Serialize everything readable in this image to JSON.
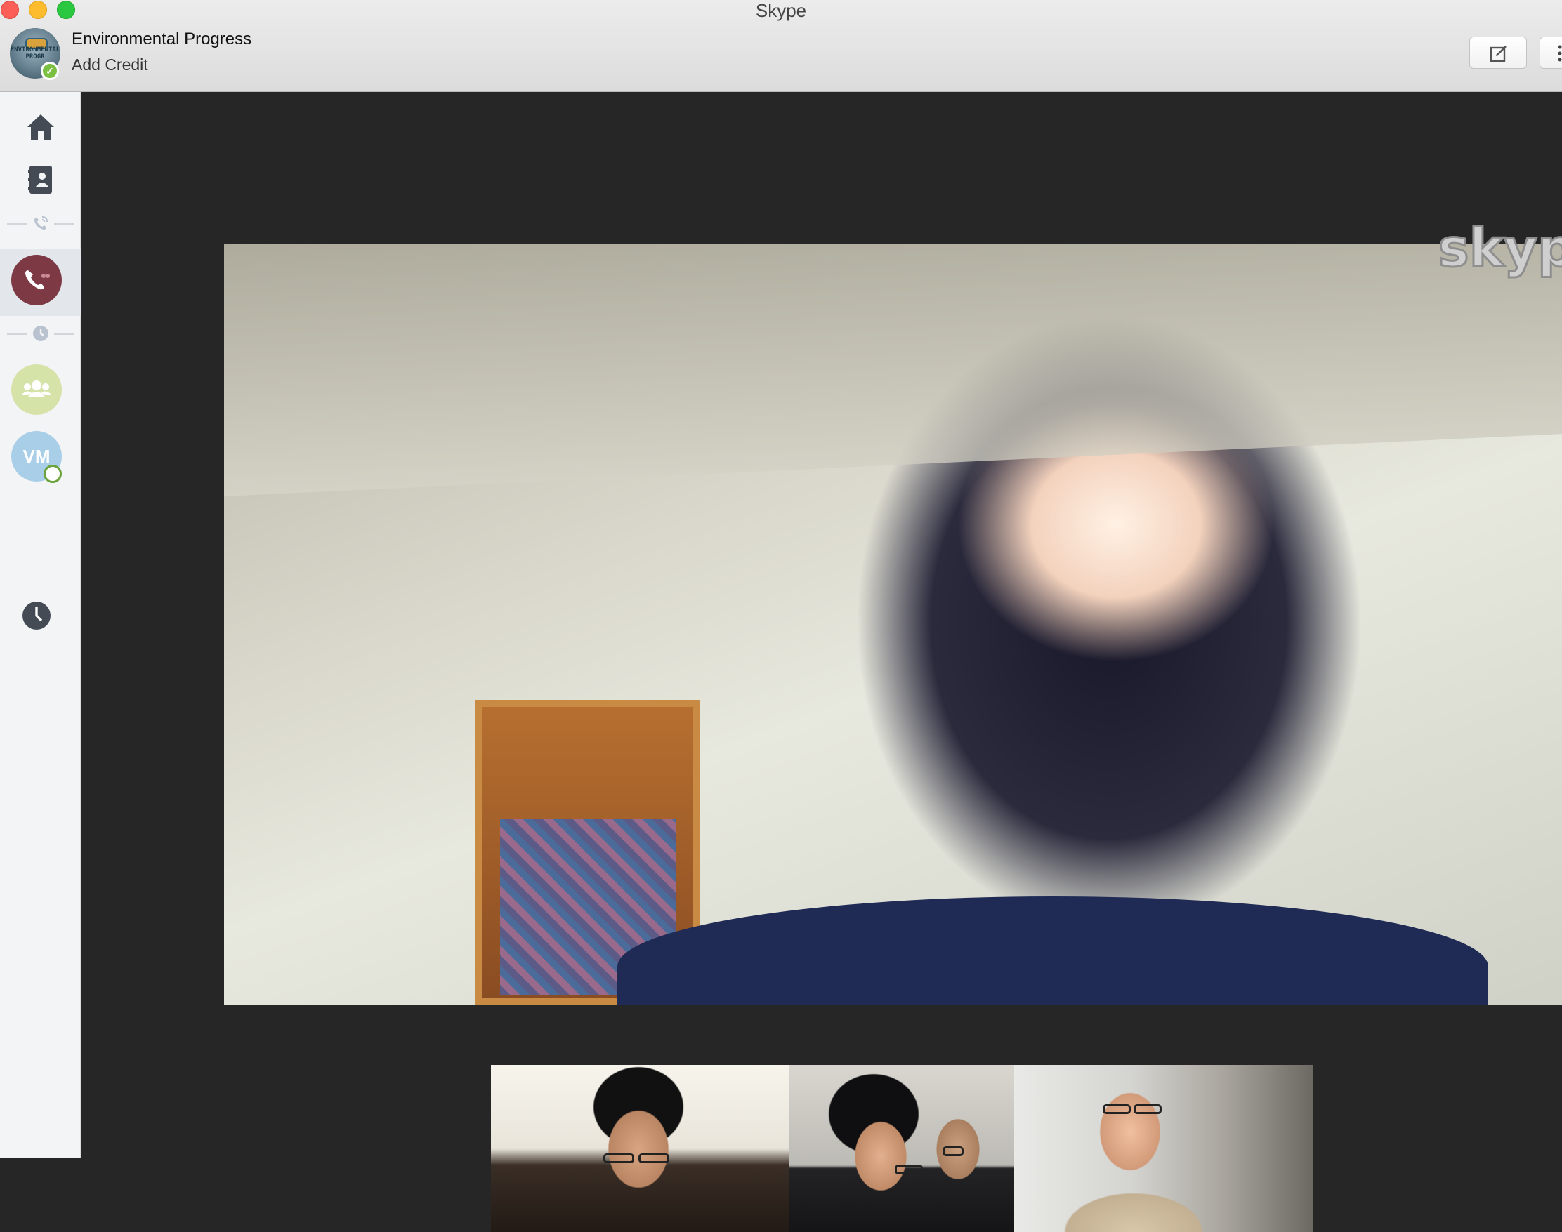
{
  "window": {
    "title": "Skype"
  },
  "account": {
    "name": "Environmental Progress",
    "add_credit": "Add Credit",
    "avatar_text": "ENVIRONMENTAL PROGR"
  },
  "sidebar": {
    "items": [
      {
        "name": "home",
        "icon": "home-icon"
      },
      {
        "name": "contacts",
        "icon": "contacts-book-icon"
      },
      {
        "name": "calls-divider",
        "icon": "phone-ringing-icon"
      },
      {
        "name": "active-call",
        "icon": "phone-icon"
      },
      {
        "name": "recent-divider",
        "icon": "clock-icon"
      },
      {
        "name": "group-call",
        "icon": "group-icon"
      },
      {
        "name": "vm-contact",
        "initials": "VM"
      },
      {
        "name": "history",
        "icon": "clock-icon"
      }
    ]
  },
  "watermark": "skype",
  "colors": {
    "active_call": "#7d3a45",
    "group_avatar": "#d5e3a8",
    "vm_avatar": "#a9cfe8",
    "online_status": "#7bc043",
    "video_background": "#262626"
  }
}
